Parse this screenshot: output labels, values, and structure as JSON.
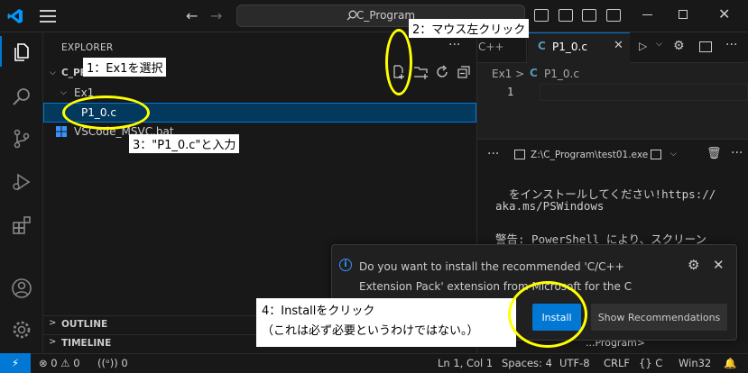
{
  "titlebar": {
    "search_text": "C_Program",
    "search_icon": "search-icon"
  },
  "sidebar": {
    "title": "EXPLORER",
    "more": "···",
    "root_folder": "C_PR",
    "items": [
      {
        "label": "Ex1",
        "type": "folder"
      },
      {
        "label": "P1_0.c",
        "type": "file",
        "selected": true
      },
      {
        "label": "VSCode_MSVC.bat",
        "type": "file"
      }
    ],
    "outline_label": "OUTLINE",
    "timeline_label": "TIMELINE"
  },
  "editor": {
    "prev_tab_label": "C++",
    "active_tab_icon": "C",
    "active_tab_label": "P1_0.c",
    "breadcrumb_folder": "Ex1 >",
    "breadcrumb_icon": "C",
    "breadcrumb_file": "P1_0.c",
    "line_number": "1"
  },
  "panel": {
    "more": "···",
    "terminal_name": "Z:\\C_Program\\test01.exe",
    "lines": [
      "  をインストールしてください!https://",
      "aka.ms/PSWindows",
      "",
      "警告: PowerShell により、スクリーン"
    ],
    "prompt_fragment": "...Program>"
  },
  "notification": {
    "info_glyph": "i",
    "message": "Do you want to install the recommended 'C/C++ Extension Pack' extension from Microsoft for the C language?",
    "install_label": "Install",
    "recommendations_label": "Show Recommendations"
  },
  "statusbar": {
    "remote_glyph": "⚡",
    "problems": "⊗ 0 ⚠ 0",
    "ports": "((ᵒ)) 0",
    "cursor": "Ln 1, Col 1",
    "spaces": "Spaces: 4",
    "encoding": "UTF-8",
    "eol": "CRLF",
    "language": "{} C",
    "platform": "Win32"
  },
  "annotations": {
    "step1": "1：Ex1を選択",
    "step2": "2：マウス左クリック",
    "step3": "3：\"P1_0.c\"と入力",
    "step4_line1": "4：Installをクリック",
    "step4_line2": "（これは必ず必要というわけではない。）"
  },
  "colors": {
    "accent": "#0078d4",
    "selection": "#04395e",
    "annotation_ring": "#ffff00",
    "c_icon": "#519aba"
  }
}
